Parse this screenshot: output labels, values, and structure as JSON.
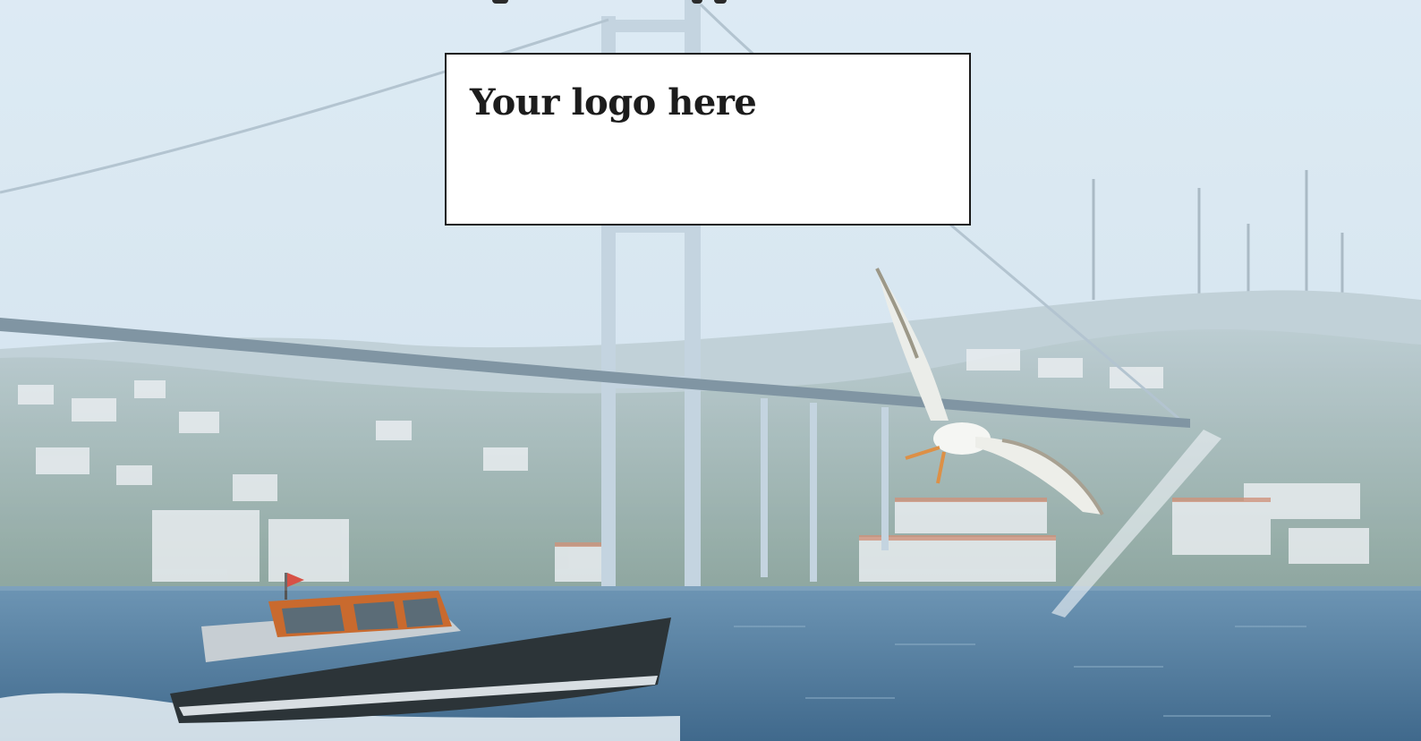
{
  "logo": {
    "placeholder_text": "Your logo here"
  },
  "colors": {
    "sky": "#d6e6f2",
    "water": "#4f7a9c",
    "hill": "#8fa9a6",
    "bridge": "#bcd0de",
    "boat_hull": "#2c3438",
    "cabin_trim": "#c96a2e"
  },
  "scene": {
    "subjects": [
      "suspension-bridge",
      "hillside-town",
      "motor-yacht",
      "seagull",
      "sea"
    ]
  }
}
